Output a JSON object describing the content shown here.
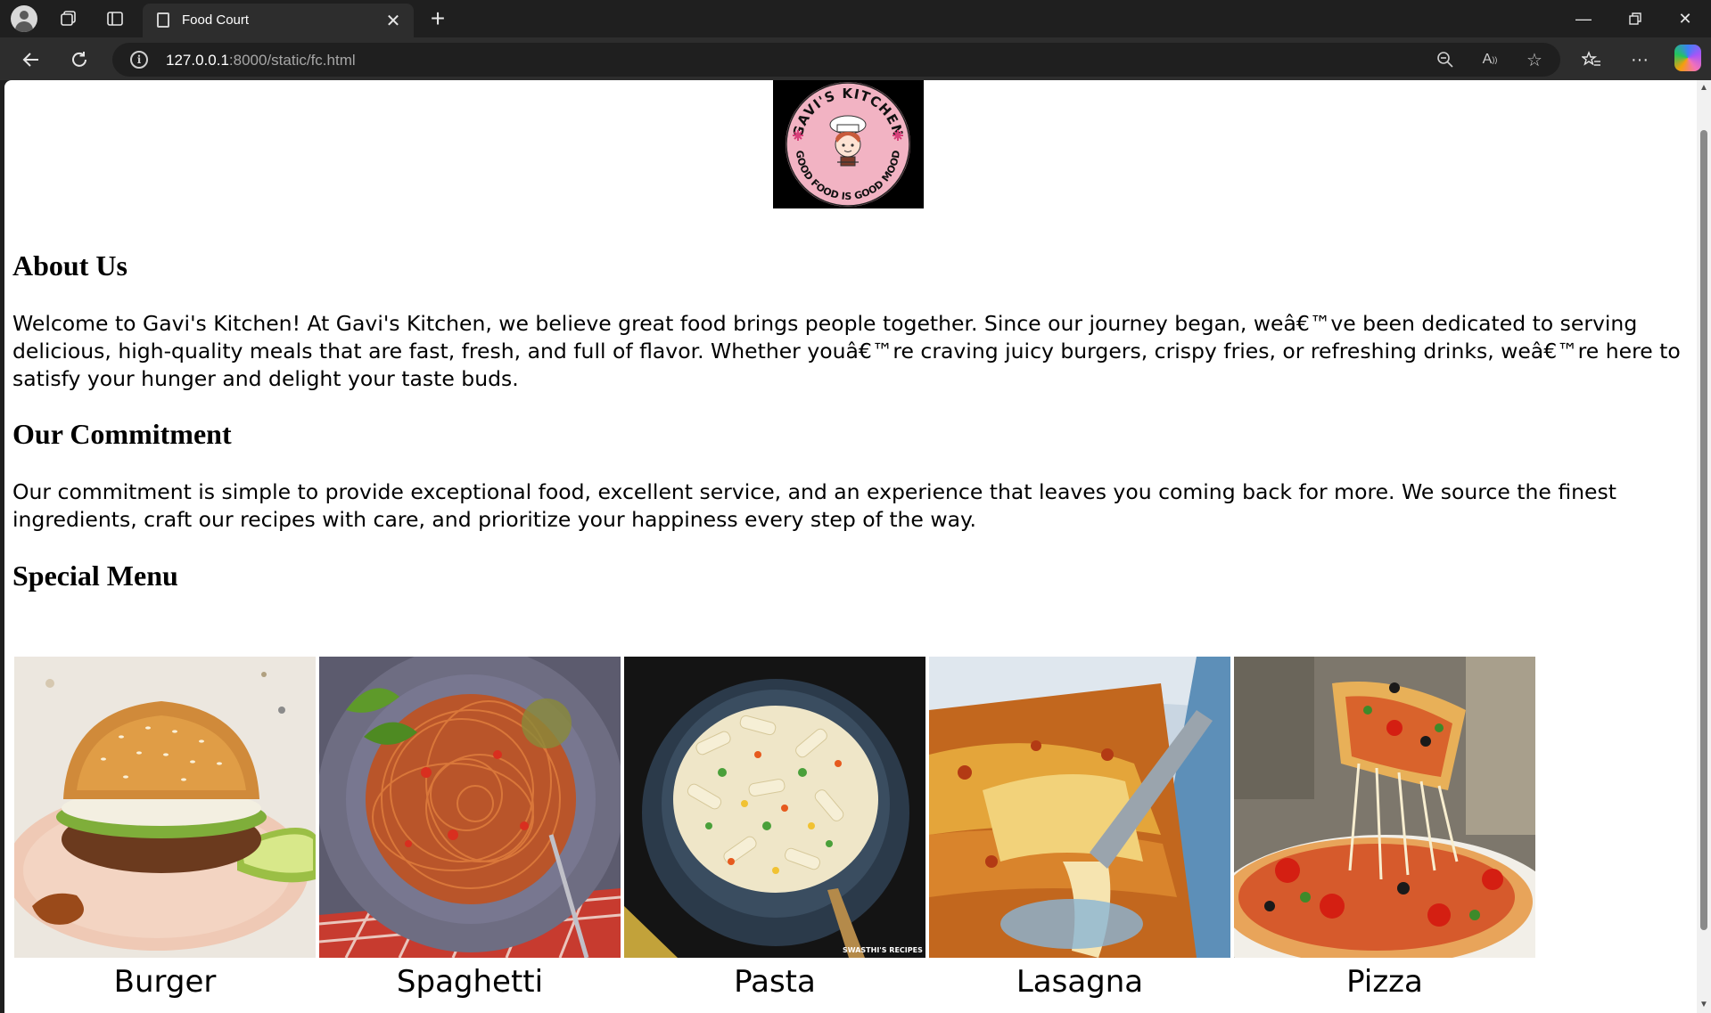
{
  "browser": {
    "tab_title": "Food Court",
    "url_host": "127.0.0.1",
    "url_path": ":8000/static/fc.html"
  },
  "page": {
    "logo": {
      "top_text": "GAVI'S KITCHEN",
      "bottom_text": "GOOD FOOD IS GOOD MOOD"
    },
    "about_heading": "About Us",
    "about_text": "Welcome to Gavi's Kitchen! At Gavi's Kitchen, we believe great food brings people together. Since our journey began, weâ€™ve been dedicated to serving delicious, high-quality meals that are fast, fresh, and full of flavor. Whether youâ€™re craving juicy burgers, crispy fries, or refreshing drinks, weâ€™re here to satisfy your hunger and delight your taste buds.",
    "commitment_heading": "Our Commitment",
    "commitment_text": "Our commitment is simple to provide exceptional food, excellent service, and an experience that leaves you coming back for more. We source the finest ingredients, craft our recipes with care, and prioritize your happiness every step of the way.",
    "menu_heading": "Special Menu",
    "menu_items": [
      {
        "name": "Burger"
      },
      {
        "name": "Spaghetti"
      },
      {
        "name": "Pasta",
        "watermark": "SWASTHI'S RECIPES"
      },
      {
        "name": "Lasagna"
      },
      {
        "name": "Pizza"
      }
    ]
  }
}
